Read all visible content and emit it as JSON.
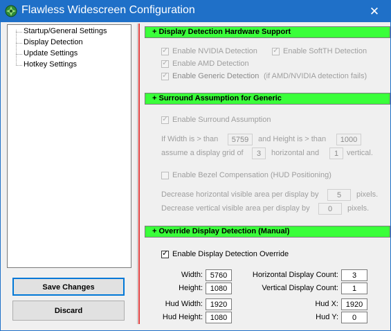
{
  "window": {
    "title": "Flawless Widescreen Configuration",
    "close_glyph": "✕"
  },
  "tree": {
    "items": [
      "Startup/General Settings",
      "Display Detection",
      "Update Settings",
      "Hotkey Settings"
    ]
  },
  "buttons": {
    "save": "Save Changes",
    "discard": "Discard"
  },
  "sections": {
    "hardware": {
      "title": "+ Display Detection Hardware Support",
      "nvidia": "Enable NVIDIA Detection",
      "softth": "Enable SoftTH Detection",
      "amd": "Enable AMD Detection",
      "generic": "Enable Generic Detection",
      "generic_note": "(if AMD/NVIDIA detection fails)"
    },
    "surround": {
      "title": "+ Surround Assumption for Generic",
      "enable": "Enable Surround Assumption",
      "if_width": "If Width is > than",
      "width_value": "5759",
      "and_height": "and Height is > than",
      "height_value": "1000",
      "assume_grid": "assume a display grid of",
      "grid_h_value": "3",
      "horizontal_and": "horizontal and",
      "grid_v_value": "1",
      "vertical": "vertical.",
      "bezel": "Enable Bezel Compensation (HUD Positioning)",
      "dec_h": "Decrease horizontal visible area per display by",
      "dec_h_value": "5",
      "dec_v": "Decrease vertical visible area per display by",
      "dec_v_value": "0",
      "pixels": "pixels."
    },
    "override": {
      "title": "+ Override Display Detection (Manual)",
      "enable": "Enable Display Detection Override",
      "width_label": "Width:",
      "width_value": "5760",
      "height_label": "Height:",
      "height_value": "1080",
      "hud_width_label": "Hud Width:",
      "hud_width_value": "1920",
      "hud_height_label": "Hud Height:",
      "hud_height_value": "1080",
      "h_count_label": "Horizontal Display Count:",
      "h_count_value": "3",
      "v_count_label": "Vertical Display Count:",
      "v_count_value": "1",
      "hud_x_label": "Hud X:",
      "hud_x_value": "1920",
      "hud_y_label": "Hud Y:",
      "hud_y_value": "0"
    }
  },
  "colors": {
    "titlebar": "#1f70c8",
    "section_header": "#3aff3a",
    "divider": "#e04040"
  }
}
